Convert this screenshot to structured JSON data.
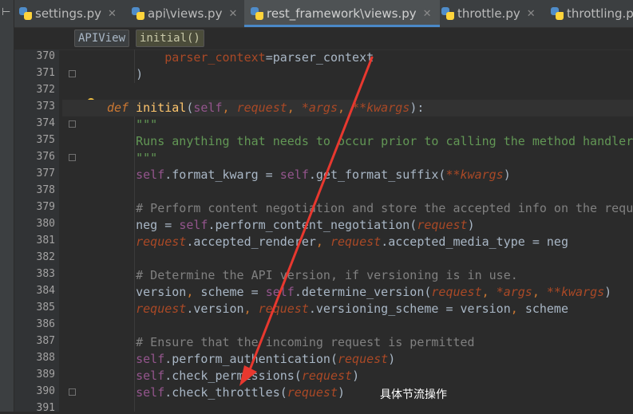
{
  "tabs": [
    {
      "label": "settings.py",
      "active": false
    },
    {
      "label": "api\\views.py",
      "active": false
    },
    {
      "label": "rest_framework\\views.py",
      "active": true
    },
    {
      "label": "throttle.py",
      "active": false
    },
    {
      "label": "throttling.p",
      "active": false
    }
  ],
  "breadcrumb": [
    "APIView",
    "initial()"
  ],
  "line_numbers": [
    "370",
    "371",
    "372",
    "373",
    "374",
    "375",
    "376",
    "377",
    "378",
    "379",
    "380",
    "381",
    "382",
    "383",
    "384",
    "385",
    "386",
    "387",
    "388",
    "389",
    "390",
    "391"
  ],
  "annotation": "具体节流操作",
  "code": {
    "l370": {
      "a": "        ",
      "b": "parser_context",
      "c": "=",
      "d": "parser_context"
    },
    "l371": {
      "a": "    )"
    },
    "l373": {
      "a": "def ",
      "b": "initial",
      "c": "(",
      "d": "self",
      "e": ", ",
      "f": "request",
      "g": ", ",
      "h": "*args",
      "i": ", ",
      "j": "**kwargs",
      "k": "):"
    },
    "l374": {
      "a": "    \"\"\""
    },
    "l375": {
      "a": "    Runs anything that needs to occur prior to calling the method handler."
    },
    "l376": {
      "a": "    \"\"\""
    },
    "l377": {
      "a": "    ",
      "b": "self",
      ".": ".",
      "c": "format_kwarg = ",
      "d": "self",
      "e": ".get_format_suffix(",
      "f": "**kwargs",
      "g": ")"
    },
    "l379": {
      "a": "    # Perform content negotiation and store the accepted info on the request"
    },
    "l380": {
      "a": "    neg = ",
      "b": "self",
      "c": ".perform_content_negotiation(",
      "d": "request",
      "e": ")"
    },
    "l381": {
      "a": "    ",
      "b": "request",
      "c": ".accepted_renderer",
      ",": ", ",
      "d": "request",
      "e": ".accepted_media_type = neg"
    },
    "l383": {
      "a": "    # Determine the API version, if versioning is in use."
    },
    "l384": {
      "a": "    version",
      ",1": ", ",
      "b": "scheme = ",
      "c": "self",
      "d": ".determine_version(",
      "e": "request",
      "f": ", ",
      "g": "*args",
      "h": ", ",
      "i": "**kwargs",
      "j": ")"
    },
    "l385": {
      "a": "    ",
      "b": "request",
      "c": ".version",
      ",": ", ",
      "d": "request",
      "e": ".versioning_scheme = version",
      ",2": ", ",
      "f": "scheme"
    },
    "l387": {
      "a": "    # Ensure that the incoming request is permitted"
    },
    "l388": {
      "a": "    ",
      "b": "self",
      "c": ".perform_authentication(",
      "d": "request",
      "e": ")"
    },
    "l389": {
      "a": "    ",
      "b": "self",
      "c": ".check_permissions(",
      "d": "request",
      "e": ")"
    },
    "l390": {
      "a": "    ",
      "b": "self",
      "c": ".check_throttles(",
      "d": "request",
      "e": ")"
    }
  },
  "colors": {
    "arrow": "#e8382f",
    "accent": "#4a88c7"
  }
}
